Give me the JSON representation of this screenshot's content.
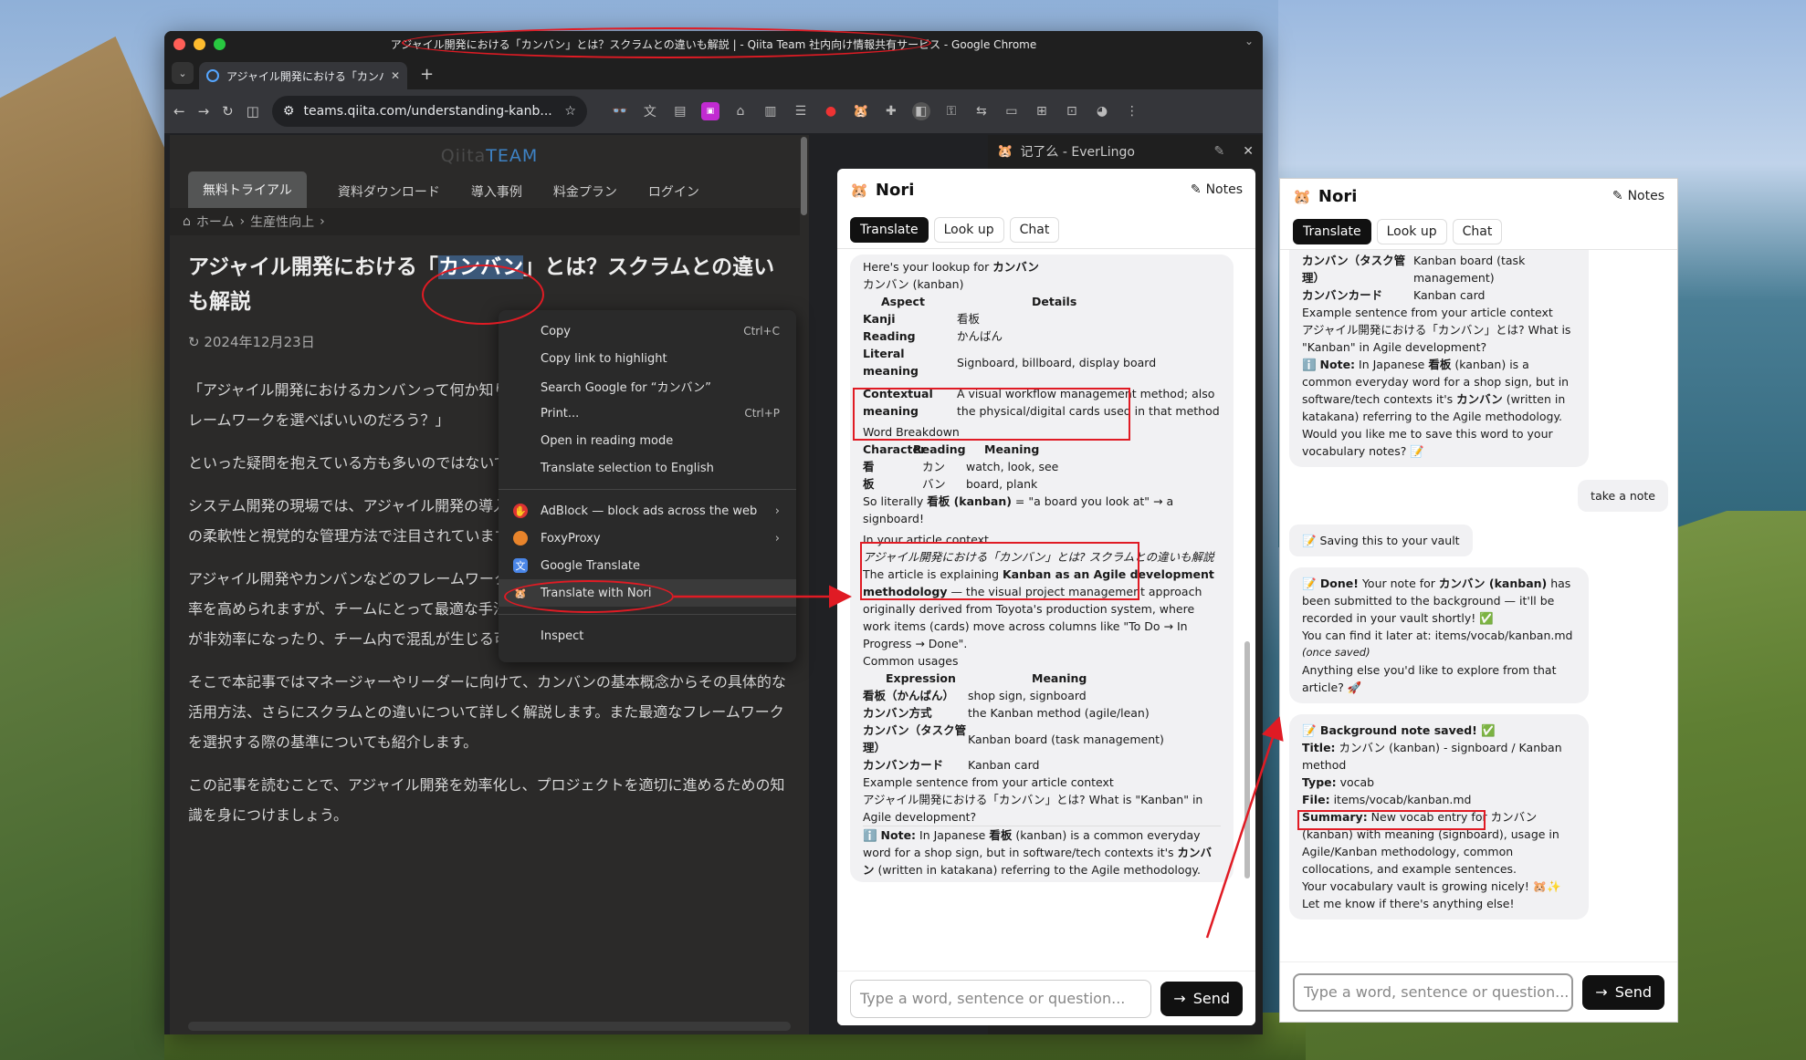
{
  "window": {
    "title": "アジャイル開発における「カンバン」とは？スクラムとの違いも解説 | - Qiita Team 社内向け情報共有サービス - Google Chrome",
    "tab_title": "アジャイル開発における「カンバ",
    "url": "teams.qiita.com/understanding-kanb..."
  },
  "page": {
    "logo_a": "Qiita",
    "logo_b": "TEAM",
    "nav": [
      "無料トライアル",
      "資料ダウンロード",
      "導入事例",
      "料金プラン",
      "ログイン"
    ],
    "breadcrumb": [
      "ホーム",
      "生産性向上"
    ],
    "title_pre": "アジャイル開発における「",
    "title_hl": "カンバン",
    "title_post": "」とは？スクラムとの違いも解説",
    "date": "2024年12月23日",
    "para1": "「アジャイル開発におけるカンバンって何か知りたい」「アジャイルを導入する時にどのフレームワークを選べばいいのだろう？」",
    "para2": "といった疑問を抱えている方も多いのではないでしょうか。",
    "para3": "システム開発の現場では、アジャイル開発の導入が進んでいます。特に「カンバン」は、その柔軟性と視覚的な管理方法で注目されています。",
    "para4": "アジャイル開発やカンバンなどのフレームワークを効果的に使えればプロジェクトの成功確率を高められますが、チームにとって最適な手法が選択できないと、逆にプロジェクト管理が非効率になったり、チーム内で混乱が生じる可能性もあります。",
    "para5": "そこで本記事ではマネージャーやリーダーに向けて、カンバンの基本概念からその具体的な活用方法、さらにスクラムとの違いについて詳しく解説します。また最適なフレームワークを選択する際の基準についても紹介します。",
    "para6": "この記事を読むことで、アジャイル開発を効率化し、プロジェクトを適切に進めるための知識を身につけましょう。"
  },
  "context_menu": {
    "copy": "Copy",
    "copy_sc": "Ctrl+C",
    "copy_link": "Copy link to highlight",
    "search": "Search Google for “カンバン”",
    "print": "Print...",
    "print_sc": "Ctrl+P",
    "reading": "Open in reading mode",
    "translate_sel": "Translate selection to English",
    "adblock": "AdBlock — block ads across the web",
    "foxy": "FoxyProxy",
    "gtranslate": "Google Translate",
    "nori": "Translate with Nori",
    "inspect": "Inspect"
  },
  "side_panel": {
    "title": "记了么 - EverLingo"
  },
  "nori": {
    "name": "Nori",
    "notes": "Notes",
    "tabs": [
      "Translate",
      "Look up",
      "Chat"
    ],
    "placeholder": "Type a word, sentence or question...",
    "send": "Send"
  },
  "lookup": {
    "intro_a": "Here's your lookup for ",
    "intro_b": "カンバン",
    "reading_line": "カンバン (kanban)",
    "h_aspect": "Aspect",
    "h_details": "Details",
    "rows": [
      {
        "k": "Kanji",
        "v": "看板"
      },
      {
        "k": "Reading",
        "v": "かんばん"
      },
      {
        "k": "Literal meaning",
        "v": "Signboard, billboard, display board"
      },
      {
        "k": "Contextual meaning",
        "v": "A visual workflow management method; also the physical/digital cards used in that method"
      }
    ],
    "wb": "Word Breakdown",
    "wb_h1": "Character",
    "wb_h2": "Reading",
    "wb_h3": "Meaning",
    "wb_rows": [
      [
        "看",
        "カン",
        "watch, look, see"
      ],
      [
        "板",
        "バン",
        "board, plank"
      ]
    ],
    "literally_a": "So literally ",
    "literally_b": "看板 (kanban)",
    "literally_c": " = \"a board you look at\" → a signboard!",
    "ctx_h": "In your article context",
    "ctx_q": "アジャイル開発における「カンバン」とは? スクラムとの違いも解説",
    "expl_a": "The article is explaining ",
    "expl_b": "Kanban as an Agile development methodology",
    "expl_c": " — the visual project management approach originally derived from Toyota's production system, where work items (cards) move across columns like \"To Do → In Progress → Done\".",
    "cu": "Common usages",
    "cu_h1": "Expression",
    "cu_h2": "Meaning",
    "cu_rows": [
      [
        "看板（かんばん）",
        "shop sign, signboard"
      ],
      [
        "カンバン方式",
        "the Kanban method (agile/lean)"
      ],
      [
        "カンバン（タスク管理）",
        "Kanban board (task management)"
      ],
      [
        "カンバンカード",
        "Kanban card"
      ]
    ],
    "ex_h": "Example sentence from your article context",
    "ex_jp": "アジャイル開発における「カンバン」とは?",
    "ex_en": "What is \"Kanban\" in Agile development?",
    "note_a": "ℹ️ ",
    "note_b": "Note:",
    "note_c": " In Japanese ",
    "note_d": "看板",
    "note_e": " (kanban) is a common everyday word for a shop sign, but in software/tech contexts it's ",
    "note_f": "カンバン",
    "note_g": " (written in katakana) referring to the Agile methodology.",
    "ask": "Would you like me to save this word to your vocabulary notes? 📝"
  },
  "chat": {
    "user_msg": "take a note",
    "saving": "📝 Saving this to your vault",
    "done_a": "📝 Done!",
    "done_b": " Your note for ",
    "done_c": "カンバン (kanban)",
    "done_d": " has been submitted to the background — it'll be recorded in your vault shortly! ✅",
    "find": "You can find it later at: items/vocab/kanban.md",
    "once": "(once saved)",
    "else": "Anything else you'd like to explore from that article? 🚀",
    "bg_h": "📝 Background note saved! ✅",
    "title_k": "Title:",
    "title_v": " カンバン (kanban) - signboard / Kanban method",
    "type_k": "Type:",
    "type_v": " vocab",
    "file_k": "File:",
    "file_v": " items/vocab/kanban.md",
    "sum_k": "Summary:",
    "sum_v": " New vocab entry for カンバン (kanban) with meaning (signboard), usage in Agile/Kanban methodology, common collocations, and example sentences.",
    "grow": "Your vocabulary vault is growing nicely! 🐹✨ Let me know if there's anything else!"
  },
  "colors": {
    "annotation_red": "#e01b24",
    "accent_dark": "#111111"
  }
}
